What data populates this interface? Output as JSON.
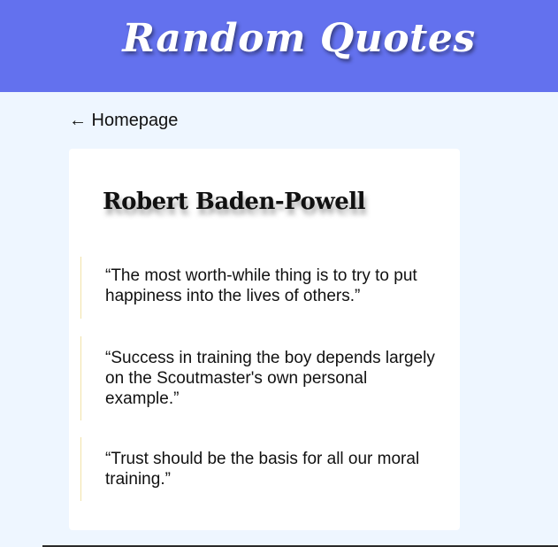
{
  "header": {
    "title": "Random Quotes",
    "background_color": "#6371ee"
  },
  "nav": {
    "back_link": "← Homepage"
  },
  "author": {
    "name": "Robert Baden-Powell"
  },
  "quotes": [
    "“The most worth-while thing is to try to put happiness into the lives of others.”",
    "“Success in training the boy depends largely on the Scoutmaster's own personal example.”",
    "“Trust should be the basis for all our moral training.”"
  ],
  "colors": {
    "page_background": "#eef6ff",
    "card_background": "#ffffff",
    "quote_border": "#f1e2a8"
  }
}
